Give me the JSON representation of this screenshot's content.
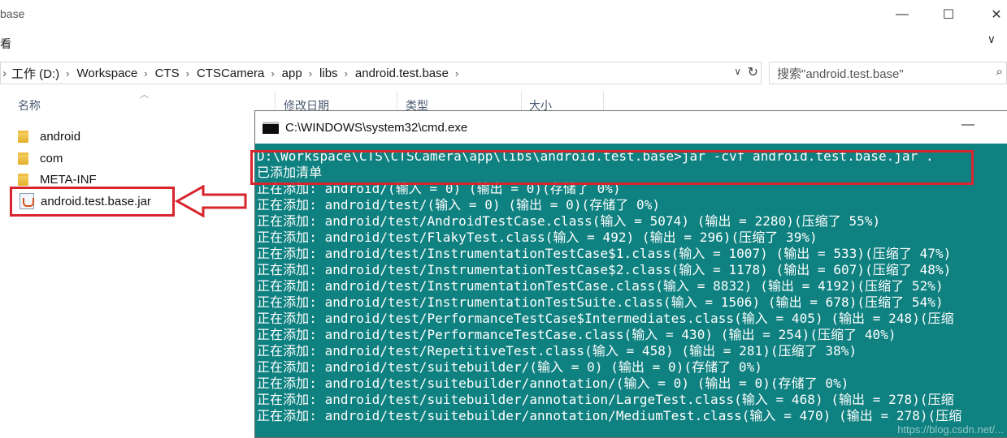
{
  "window": {
    "title": "base",
    "minimize": "—",
    "maximize": "☐",
    "close": "✕"
  },
  "ribbon": {
    "label": "看",
    "expand": "∨"
  },
  "address": {
    "back": "›",
    "crumbs": [
      "工作 (D:)",
      "Workspace",
      "CTS",
      "CTSCamera",
      "app",
      "libs",
      "android.test.base"
    ],
    "dropdown": "∨",
    "refresh": "↻"
  },
  "search": {
    "placeholder": "搜索\"android.test.base\"",
    "icon": "search-icon"
  },
  "columns": {
    "name": "名称",
    "modified": "修改日期",
    "type": "类型",
    "size": "大小",
    "sort": "︿"
  },
  "files": [
    {
      "name": "android",
      "icon": "folder-icon"
    },
    {
      "name": "com",
      "icon": "folder-icon"
    },
    {
      "name": "META-INF",
      "icon": "folder-icon"
    },
    {
      "name": "android.test.base.jar",
      "icon": "jar-icon"
    }
  ],
  "colors": {
    "terminal_bg": "#0f8180",
    "highlight": "#d8242c",
    "folder": "#e8b536"
  },
  "cmd": {
    "title": "C:\\WINDOWS\\system32\\cmd.exe",
    "minimize": "—",
    "lines": [
      "D:\\Workspace\\CTS\\CTSCamera\\app\\libs\\android.test.base>jar -cvf android.test.base.jar .",
      "已添加清单",
      "正在添加: android/(输入 = 0) (输出 = 0)(存储了 0%)",
      "正在添加: android/test/(输入 = 0) (输出 = 0)(存储了 0%)",
      "正在添加: android/test/AndroidTestCase.class(输入 = 5074) (输出 = 2280)(压缩了 55%)",
      "正在添加: android/test/FlakyTest.class(输入 = 492) (输出 = 296)(压缩了 39%)",
      "正在添加: android/test/InstrumentationTestCase$1.class(输入 = 1007) (输出 = 533)(压缩了 47%)",
      "正在添加: android/test/InstrumentationTestCase$2.class(输入 = 1178) (输出 = 607)(压缩了 48%)",
      "正在添加: android/test/InstrumentationTestCase.class(输入 = 8832) (输出 = 4192)(压缩了 52%)",
      "正在添加: android/test/InstrumentationTestSuite.class(输入 = 1506) (输出 = 678)(压缩了 54%)",
      "正在添加: android/test/PerformanceTestCase$Intermediates.class(输入 = 405) (输出 = 248)(压缩",
      "正在添加: android/test/PerformanceTestCase.class(输入 = 430) (输出 = 254)(压缩了 40%)",
      "正在添加: android/test/RepetitiveTest.class(输入 = 458) (输出 = 281)(压缩了 38%)",
      "正在添加: android/test/suitebuilder/(输入 = 0) (输出 = 0)(存储了 0%)",
      "正在添加: android/test/suitebuilder/annotation/(输入 = 0) (输出 = 0)(存储了 0%)",
      "正在添加: android/test/suitebuilder/annotation/LargeTest.class(输入 = 468) (输出 = 278)(压缩",
      "正在添加: android/test/suitebuilder/annotation/MediumTest.class(输入 = 470) (输出 = 278)(压缩"
    ],
    "watermark": "https://blog.csdn.net/..."
  }
}
